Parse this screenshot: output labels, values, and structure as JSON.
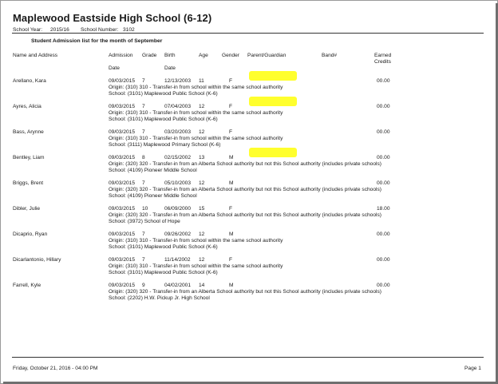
{
  "title": "Maplewood Eastside High School (6-12)",
  "school_year_label": "School Year:",
  "school_year": "2015/16",
  "school_number_label": "School Number:",
  "school_number": "3102",
  "subtitle": "Student Admission list for the month of September",
  "headers": {
    "name": "Name and Address",
    "admission": "Admission",
    "admission_date": "Date",
    "grade": "Grade",
    "birth": "Birth",
    "birth_date": "Date",
    "age": "Age",
    "gender": "Gender",
    "parent": "Parent/Guardian",
    "band": "Band#",
    "earned": "Earned",
    "credits": "Credits"
  },
  "students": [
    {
      "name": "Arellano, Kara",
      "admission": "09/03/2015",
      "grade": "7",
      "birth": "12/13/2003",
      "age": "11",
      "gender": "F",
      "credits": "00.00",
      "origin": "Origin: (310) 310 - Transfer-in from school within the same school authority",
      "school": "School: (3101) Maplewood Public School (K-6)",
      "highlighted": true
    },
    {
      "name": "Ayres, Alicia",
      "admission": "09/03/2015",
      "grade": "7",
      "birth": "07/04/2003",
      "age": "12",
      "gender": "F",
      "credits": "00.00",
      "origin": "Origin: (310) 310 - Transfer-in from school within the same school authority",
      "school": "School: (3101) Maplewood Public School (K-6)",
      "highlighted": true
    },
    {
      "name": "Bass, Arynne",
      "admission": "09/03/2015",
      "grade": "7",
      "birth": "03/20/2003",
      "age": "12",
      "gender": "F",
      "credits": "00.00",
      "origin": "Origin: (310) 310 - Transfer-in from school within the same school authority",
      "school": "School: (3111) Maplewood Primary School (K-6)",
      "highlighted": false
    },
    {
      "name": "Bentley, Liam",
      "admission": "09/03/2015",
      "grade": "8",
      "birth": "02/15/2002",
      "age": "13",
      "gender": "M",
      "credits": "00.00",
      "origin": "Origin: (320) 320 - Transfer-in from an Alberta School authority  but not this School authority (includes private schools)",
      "school": "School: (4109) Pioneer Middle School",
      "highlighted": true
    },
    {
      "name": "Briggs, Brent",
      "admission": "09/03/2015",
      "grade": "7",
      "birth": "05/10/2003",
      "age": "12",
      "gender": "M",
      "credits": "00.00",
      "origin": "Origin: (320) 320 - Transfer-in from an Alberta School authority  but not this School authority (includes private schools)",
      "school": "School: (4109) Pioneer Middle School",
      "highlighted": false
    },
    {
      "name": "Dibler, Julie",
      "admission": "09/03/2015",
      "grade": "10",
      "birth": "06/09/2000",
      "age": "15",
      "gender": "F",
      "credits": "18.00",
      "origin": "Origin: (320) 320 - Transfer-in from an Alberta School authority  but not this School authority (includes private schools)",
      "school": "School: (3972) School of Hope",
      "highlighted": false
    },
    {
      "name": "Dicaprio, Ryan",
      "admission": "09/03/2015",
      "grade": "7",
      "birth": "09/26/2002",
      "age": "12",
      "gender": "M",
      "credits": "00.00",
      "origin": "Origin: (310) 310 - Transfer-in from school within the same school authority",
      "school": "School: (3101) Maplewood Public School (K-6)",
      "highlighted": false
    },
    {
      "name": "Dicarlantonio, Hillary",
      "admission": "09/03/2015",
      "grade": "7",
      "birth": "11/14/2002",
      "age": "12",
      "gender": "F",
      "credits": "00.00",
      "origin": "Origin: (310) 310 - Transfer-in from school within the same school authority",
      "school": "School: (3101) Maplewood Public School (K-6)",
      "highlighted": false
    },
    {
      "name": "Farrell, Kyle",
      "admission": "09/03/2015",
      "grade": "9",
      "birth": "04/02/2001",
      "age": "14",
      "gender": "M",
      "credits": "00.00",
      "origin": "Origin: (320) 320 - Transfer-in from an Alberta School authority  but not this School authority (includes private schools)",
      "school": "School: (2202) H.W. Pickup Jr. High School",
      "highlighted": false
    }
  ],
  "footer": {
    "timestamp": "Friday, October 21, 2016 - 04:00 PM",
    "page": "Page 1"
  },
  "colors": {
    "highlight": "#ffff2e"
  }
}
